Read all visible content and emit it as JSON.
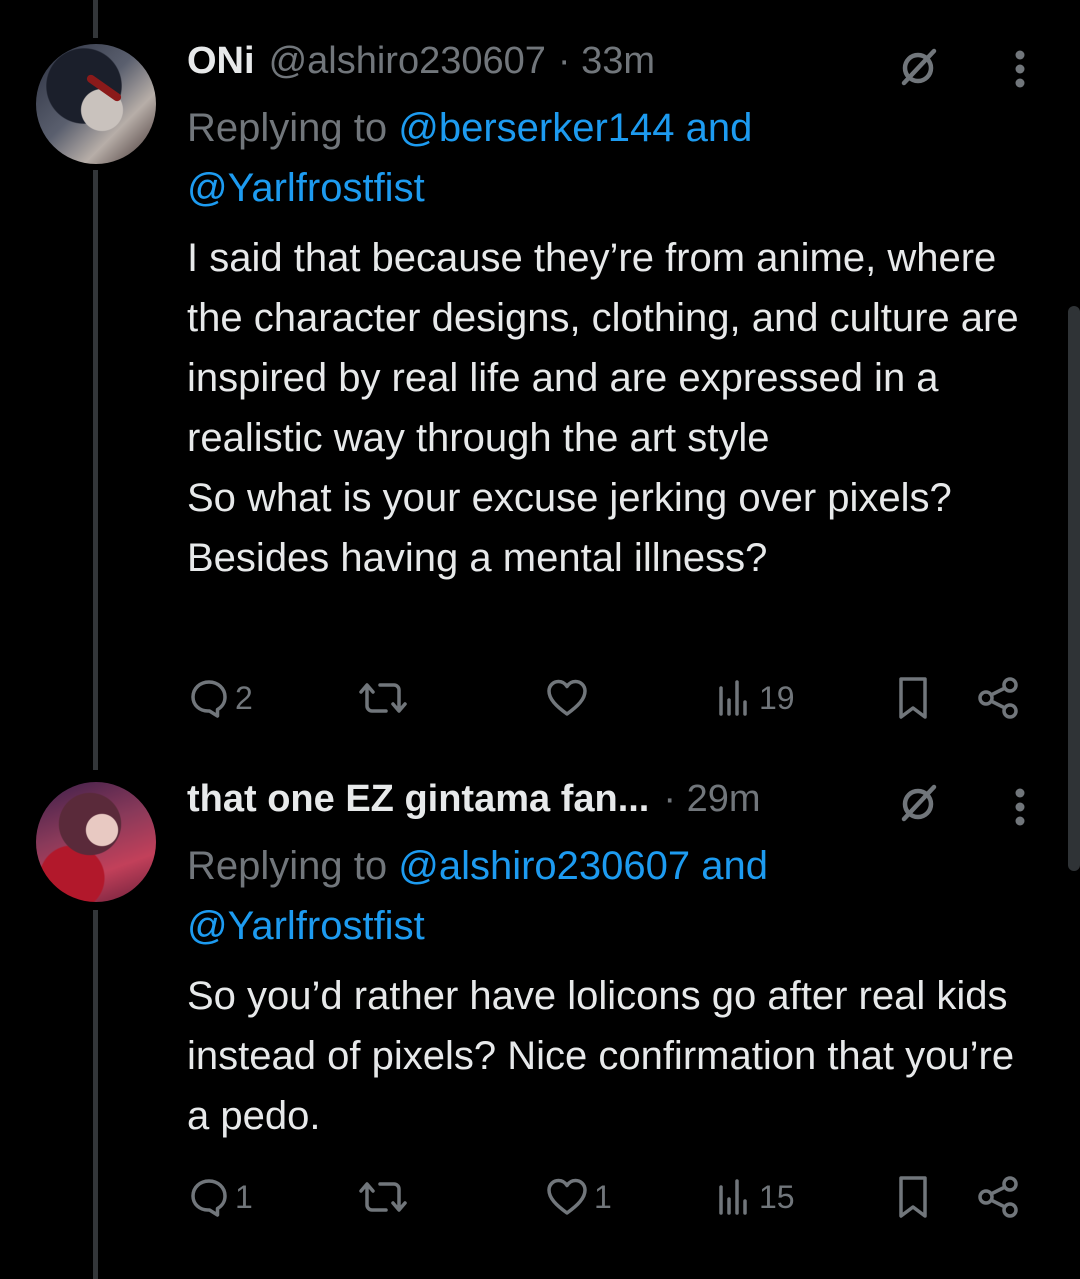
{
  "tweets": [
    {
      "display_name": "ONi",
      "handle": "@alshiro230607",
      "time": "· 33m",
      "replying_prefix": "Replying to ",
      "reply_mention_1": "@berserker144 and",
      "reply_mention_2": "@Yarlfrostfist",
      "text": "I said that because they’re from anime, where the character designs, clothing, and culture are inspired by real life and are expressed in a realistic way through the art style\nSo what is your excuse jerking over pixels? Besides having a mental illness?",
      "replies": "2",
      "reposts": "",
      "likes": "",
      "views": "19"
    },
    {
      "display_name": "that one EZ gintama fan...",
      "handle": "",
      "time": "· 29m",
      "replying_prefix": "Replying to ",
      "reply_mention_1": "@alshiro230607 and",
      "reply_mention_2": "@Yarlfrostfist",
      "text": "So you’d rather have lolicons go after real kids instead of pixels? Nice confirmation that you’re a pedo.",
      "replies": "1",
      "reposts": "",
      "likes": "1",
      "views": "15"
    }
  ],
  "icons": {
    "grok": "grok-slash-icon",
    "more": "more-vertical-icon",
    "reply": "reply-bubble-icon",
    "repost": "repost-icon",
    "like": "heart-icon",
    "views": "analytics-bars-icon",
    "bookmark": "bookmark-icon",
    "share": "share-icon"
  },
  "colors": {
    "background": "#000000",
    "text": "#e7e9ea",
    "muted": "#71767b",
    "link": "#1d9bf0",
    "thread_line": "#333639"
  }
}
